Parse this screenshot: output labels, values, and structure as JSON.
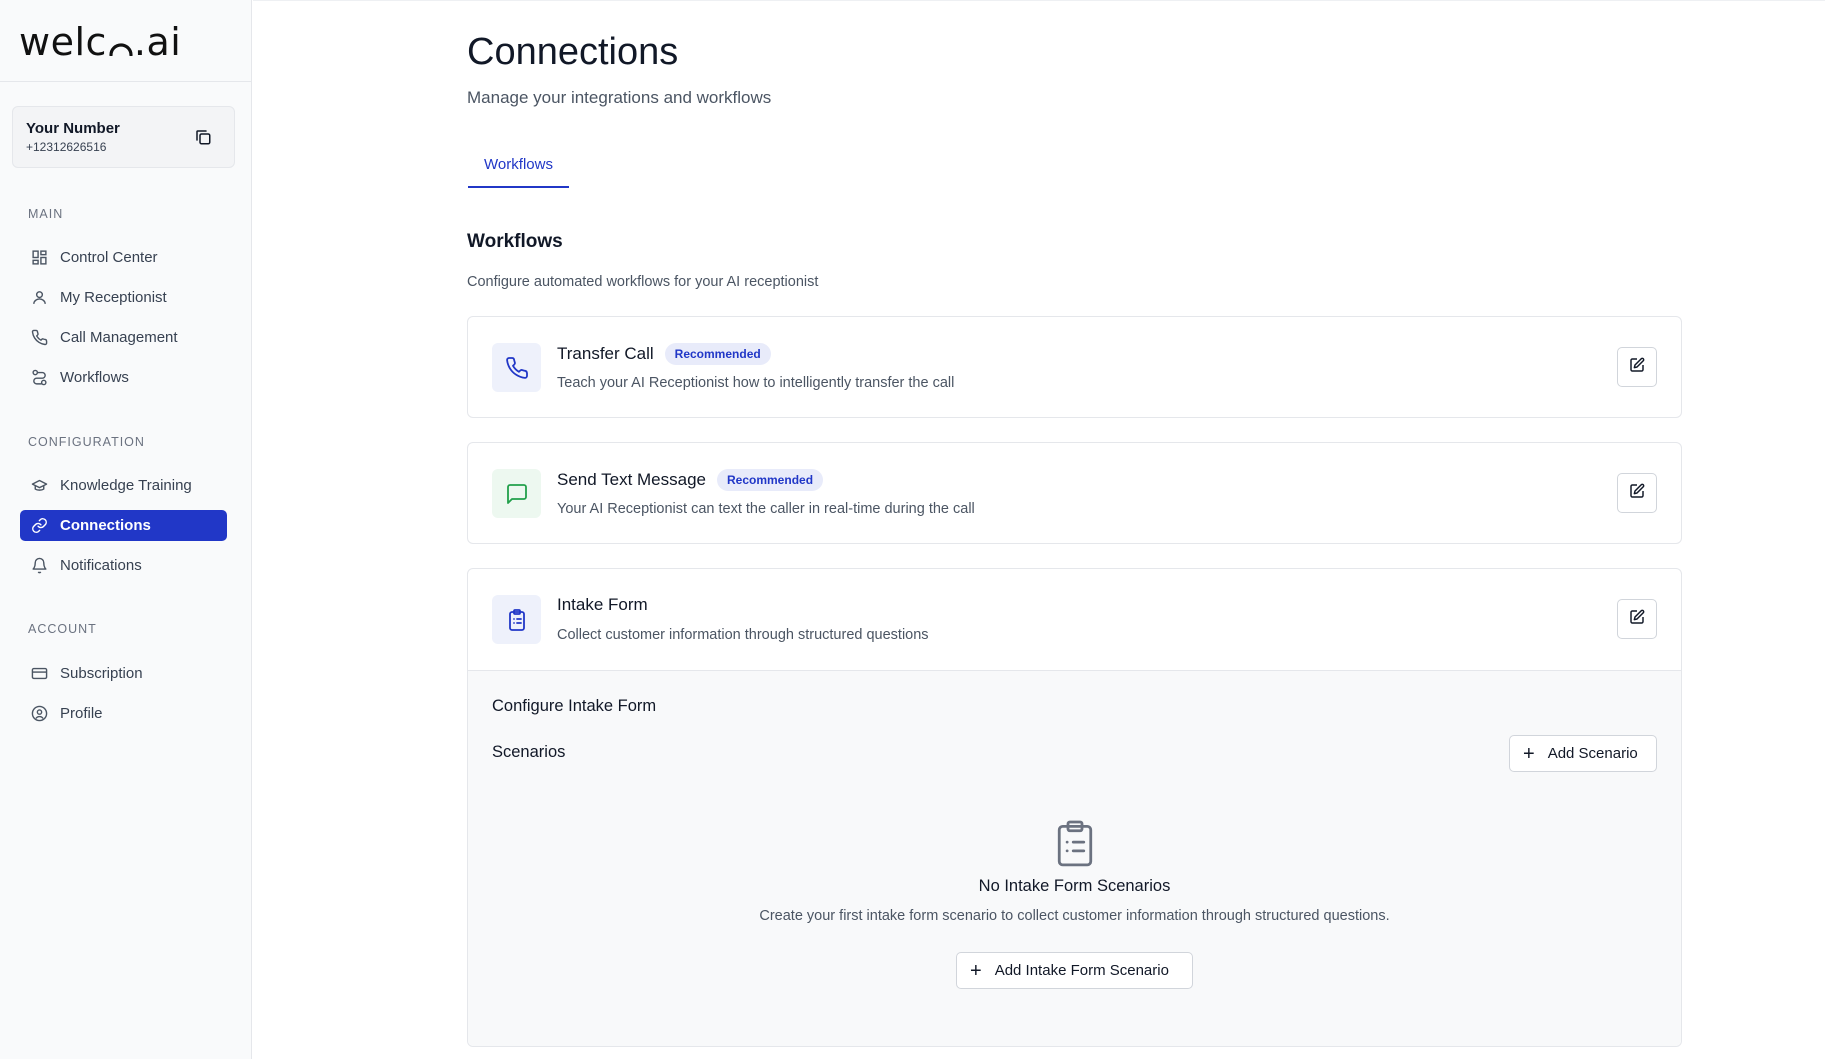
{
  "brand": {
    "logo_text_left": "welc",
    "logo_text_right": ".ai"
  },
  "phone": {
    "label": "Your Number",
    "value": "+12312626516"
  },
  "sidebar": {
    "sections": [
      {
        "title": "MAIN",
        "items": [
          {
            "label": "Control Center",
            "icon": "grid-icon"
          },
          {
            "label": "My Receptionist",
            "icon": "user-icon"
          },
          {
            "label": "Call Management",
            "icon": "phone-icon"
          },
          {
            "label": "Workflows",
            "icon": "route-icon"
          }
        ]
      },
      {
        "title": "CONFIGURATION",
        "items": [
          {
            "label": "Knowledge Training",
            "icon": "graduation-cap-icon"
          },
          {
            "label": "Connections",
            "icon": "link-icon",
            "active": true
          },
          {
            "label": "Notifications",
            "icon": "bell-icon"
          }
        ]
      },
      {
        "title": "ACCOUNT",
        "items": [
          {
            "label": "Subscription",
            "icon": "credit-card-icon"
          },
          {
            "label": "Profile",
            "icon": "user-circle-icon"
          }
        ]
      }
    ]
  },
  "page": {
    "title": "Connections",
    "subtitle": "Manage your integrations and workflows",
    "tabs": [
      {
        "label": "Workflows",
        "active": true
      }
    ]
  },
  "workflows": {
    "heading": "Workflows",
    "description": "Configure automated workflows for your AI receptionist",
    "cards": [
      {
        "title": "Transfer Call",
        "badge": "Recommended",
        "description": "Teach your AI Receptionist how to intelligently transfer the call",
        "icon": "phone-icon"
      },
      {
        "title": "Send Text Message",
        "badge": "Recommended",
        "description": "Your AI Receptionist can text the caller in real-time during the call",
        "icon": "message-icon"
      },
      {
        "title": "Intake Form",
        "badge": "",
        "description": "Collect customer information through structured questions",
        "icon": "clipboard-icon"
      }
    ]
  },
  "intake": {
    "config_title": "Configure Intake Form",
    "scenarios_title": "Scenarios",
    "add_scenario_label": "Add Scenario",
    "empty_title": "No Intake Form Scenarios",
    "empty_description": "Create your first intake form scenario to collect customer information through structured questions.",
    "add_intake_label": "Add Intake Form Scenario"
  },
  "colors": {
    "accent": "#2137c7",
    "badge_bg": "#e8ebfa",
    "green_icon": "#22a04b"
  }
}
